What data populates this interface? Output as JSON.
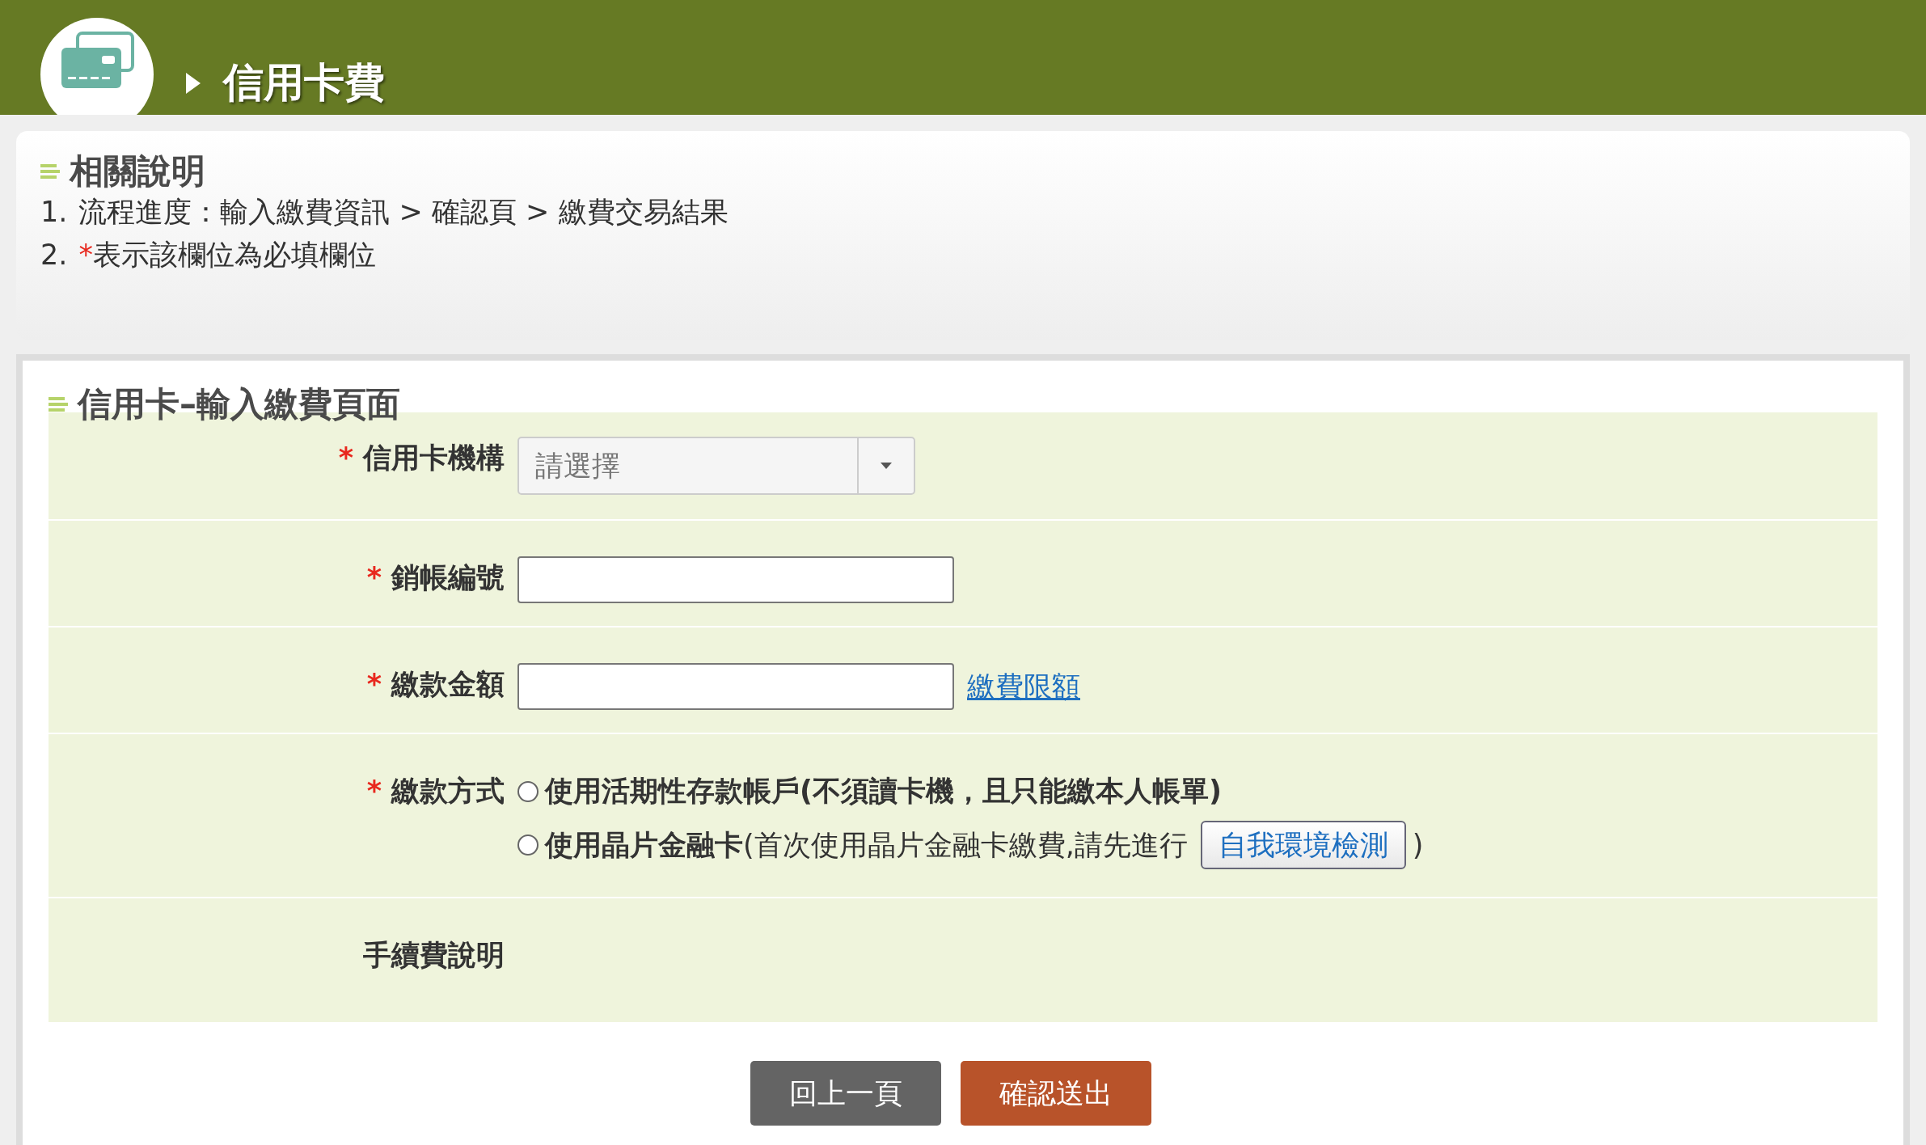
{
  "header": {
    "title": "信用卡費"
  },
  "info": {
    "heading": "相關說明",
    "items": [
      {
        "number": "1.",
        "text": "流程進度：輸入繳費資訊 > 確認頁 > 繳費交易結果"
      },
      {
        "number": "2.",
        "mark": "*",
        "text": "表示該欄位為必填欄位"
      }
    ]
  },
  "form": {
    "title": "信用卡–輸入繳費頁面",
    "fields": [
      {
        "kind": "select",
        "required_mark": "*",
        "label": "信用卡機構",
        "value": "請選擇"
      },
      {
        "kind": "text",
        "required_mark": "*",
        "label": "銷帳編號"
      },
      {
        "kind": "text",
        "required_mark": "*",
        "label": "繳款金額",
        "link": "繳費限額"
      },
      {
        "kind": "radio",
        "required_mark": "*",
        "label": "繳款方式",
        "options": [
          {
            "text": "使用活期性存款帳戶(不須讀卡機，且只能繳本人帳單)",
            "bold": true,
            "selected": false
          },
          {
            "text": "**使用晶片金融卡**(首次使用晶片金融卡繳費,請先進行",
            "bold": false,
            "button": "自我環境檢測",
            "after": ")",
            "selected": false
          }
        ]
      },
      {
        "kind": "note",
        "label": "手續費說明"
      }
    ]
  },
  "buttons": [
    {
      "kind": "back",
      "label": "回上一頁"
    },
    {
      "kind": "submit",
      "label": "確認送出"
    }
  ]
}
